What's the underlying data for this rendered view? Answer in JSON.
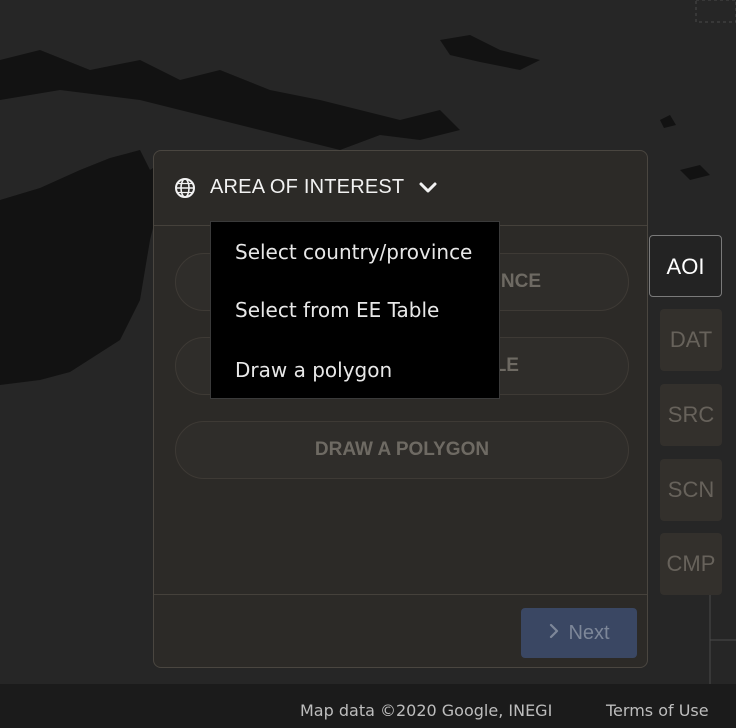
{
  "panel": {
    "title": "AREA OF INTEREST",
    "options": [
      {
        "label": "SELECT COUNTRY/PROVINCE"
      },
      {
        "label": "SELECT FROM EE TABLE"
      },
      {
        "label": "DRAW A POLYGON"
      }
    ],
    "next_label": "Next"
  },
  "dropdown": {
    "items": [
      {
        "label": "Select country/province"
      },
      {
        "label": "Select from EE Table"
      },
      {
        "label": "Draw a polygon"
      }
    ]
  },
  "steps": [
    {
      "label": "AOI",
      "state": "active"
    },
    {
      "label": "DAT",
      "state": "inactive"
    },
    {
      "label": "SRC",
      "state": "inactive"
    },
    {
      "label": "SCN",
      "state": "inactive"
    },
    {
      "label": "CMP",
      "state": "inactive"
    }
  ],
  "footer": {
    "map_data": "Map data ©2020 Google, INEGI",
    "terms": "Terms of Use"
  },
  "colors": {
    "map_background": "#262626",
    "land": "#121212",
    "panel": "#2c2a27",
    "next_button": "#3a4763"
  },
  "icons": {
    "header_icon": "globe-icon",
    "dropdown_toggle": "chevron-down-icon",
    "next_icon": "chevron-right-icon"
  }
}
